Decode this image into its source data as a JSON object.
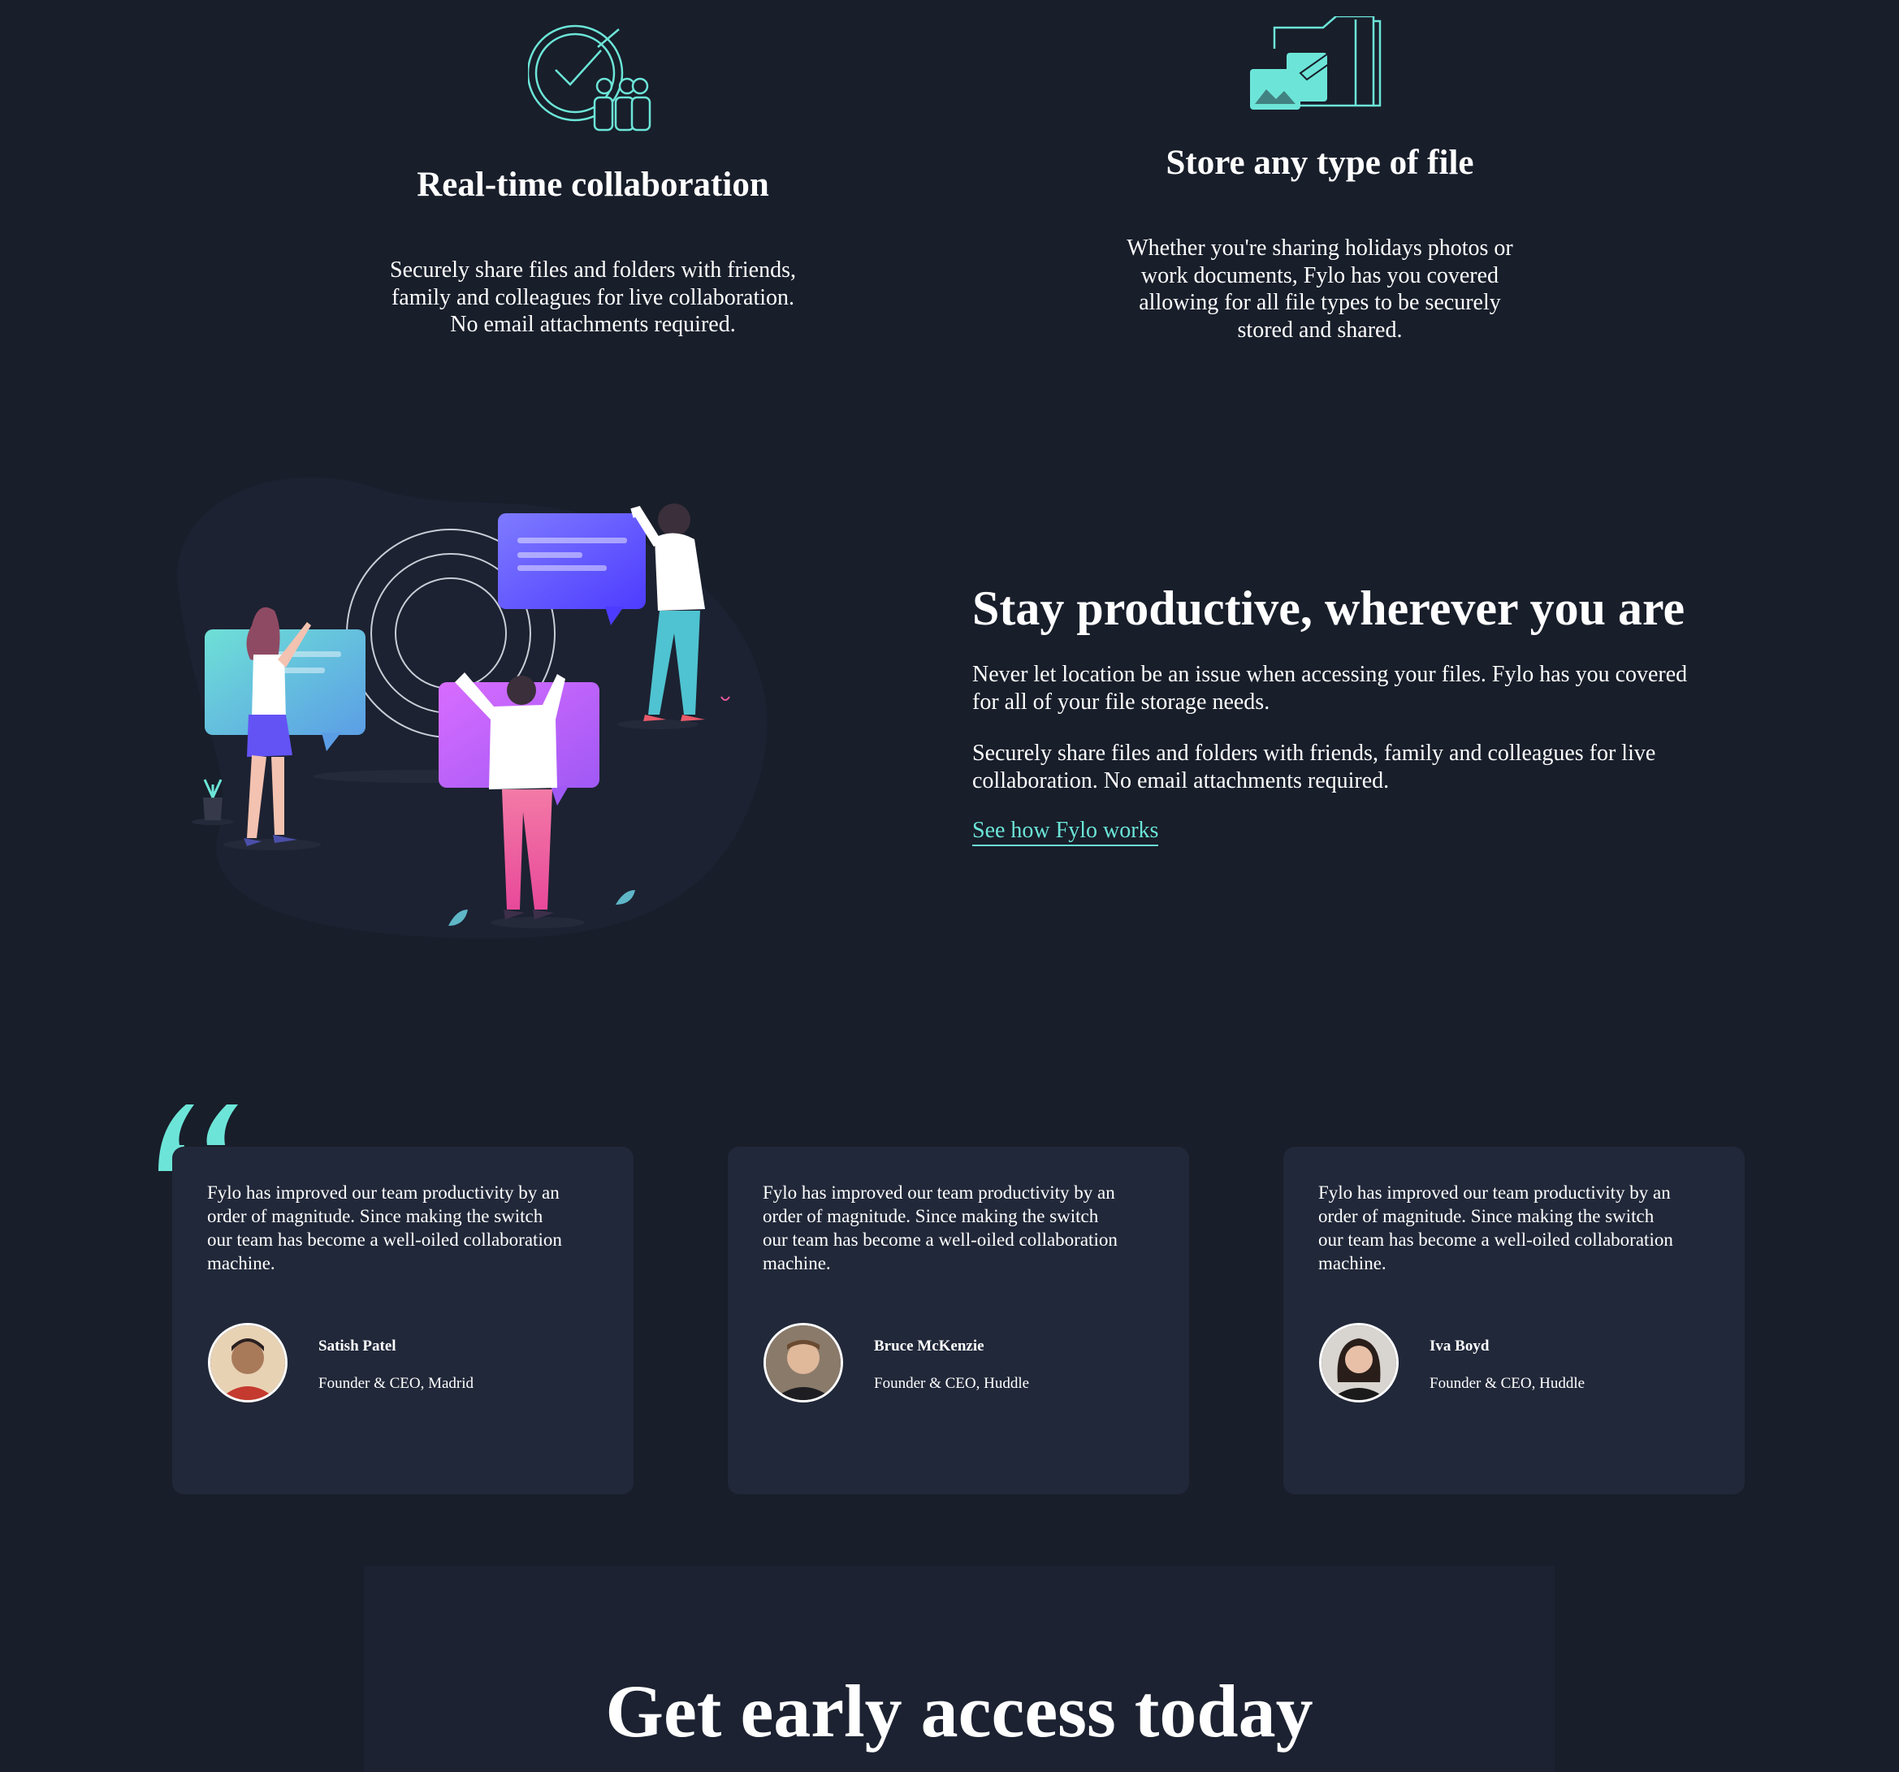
{
  "features": [
    {
      "icon": "collaboration-icon",
      "title": "Real-time collaboration",
      "lines": [
        "Securely share files and folders with friends,",
        "family and colleagues for live collaboration.",
        "No email attachments required."
      ]
    },
    {
      "icon": "file-storage-icon",
      "title": "Store any type of file",
      "lines": [
        "Whether you're sharing holidays photos or",
        "work documents, Fylo has you covered",
        "allowing for all file types to be securely",
        "stored and shared."
      ]
    }
  ],
  "productive": {
    "title": "Stay productive, wherever you are",
    "p1_lines": [
      "Never let location be an issue when accessing your files. Fylo has you covered",
      "for all of your file storage needs."
    ],
    "p2_lines": [
      "Securely share files and folders with friends, family and colleagues for live",
      "collaboration. No email attachments required."
    ],
    "link": "See how Fylo works"
  },
  "testimonials": [
    {
      "quote_lines": [
        "Fylo has improved our team productivity by an",
        "order of magnitude. Since making the switch",
        "our team has become a well-oiled collaboration",
        "machine."
      ],
      "name": "Satish Patel",
      "role": "Founder & CEO, Madrid"
    },
    {
      "quote_lines": [
        "Fylo has improved our team productivity by an",
        "order of magnitude. Since making the switch",
        "our team has become a well-oiled collaboration",
        "machine."
      ],
      "name": "Bruce McKenzie",
      "role": "Founder & CEO, Huddle"
    },
    {
      "quote_lines": [
        "Fylo has improved our team productivity by an",
        "order of magnitude. Since making the switch",
        "our team has become a well-oiled collaboration",
        "machine."
      ],
      "name": "Iva Boyd",
      "role": "Founder & CEO, Huddle"
    }
  ],
  "early_access": {
    "title": "Get early access today"
  },
  "colors": {
    "background": "#181e2a",
    "card": "#212839",
    "accent": "#6ce5d8",
    "text": "#ffffff"
  }
}
